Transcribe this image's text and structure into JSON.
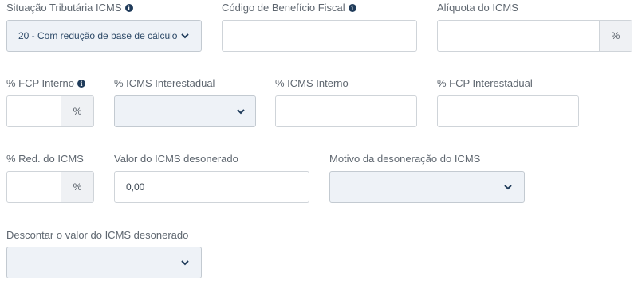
{
  "situacao_tributaria": {
    "label": "Situação Tributária ICMS",
    "value": "20 - Com redução de base de cálculo"
  },
  "codigo_beneficio": {
    "label": "Código de Benefício Fiscal",
    "value": ""
  },
  "aliquota_icms": {
    "label": "Alíquota do ICMS",
    "unit": "%"
  },
  "fcp_interno": {
    "label": "% FCP Interno",
    "unit": "%"
  },
  "icms_interestadual": {
    "label": "% ICMS Interestadual",
    "value": ""
  },
  "icms_interno": {
    "label": "% ICMS Interno",
    "value": ""
  },
  "fcp_interestadual": {
    "label": "% FCP Interestadual",
    "value": ""
  },
  "red_icms": {
    "label": "% Red. do ICMS",
    "unit": "%"
  },
  "valor_desonerado": {
    "label": "Valor do ICMS desonerado",
    "value": "0,00"
  },
  "motivo_desoneracao": {
    "label": "Motivo da desoneração do ICMS",
    "value": ""
  },
  "descontar_desonerado": {
    "label": "Descontar o valor do ICMS desonerado",
    "value": ""
  },
  "icons": {
    "info": "info-icon",
    "chevron": "chevron-down-icon"
  },
  "colors": {
    "select_bg": "#eef2f7",
    "info_icon": "#1f3b5a",
    "select_text": "#2e4a68"
  }
}
